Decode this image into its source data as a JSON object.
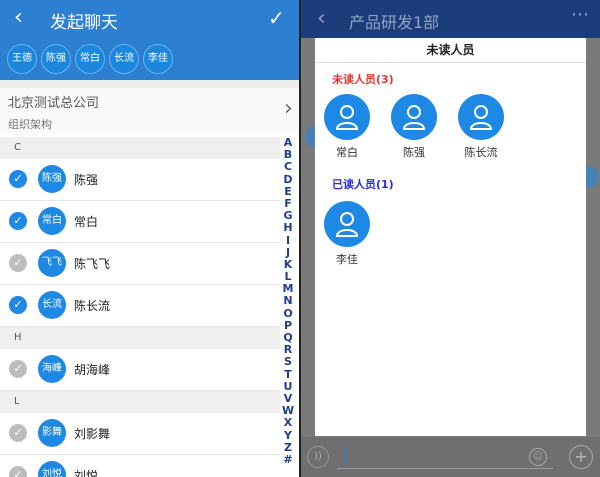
{
  "left": {
    "header": {
      "title": "发起聊天"
    },
    "selected_chips": [
      "王德",
      "陈强",
      "常白",
      "长流",
      "李佳"
    ],
    "org": {
      "name": "北京测试总公司",
      "sub": "组织架构"
    },
    "sections": [
      {
        "letter": "C",
        "rows": [
          {
            "avatar": "陈强",
            "name": "陈强",
            "checked": true
          },
          {
            "avatar": "常白",
            "name": "常白",
            "checked": true
          },
          {
            "avatar": "飞飞",
            "name": "陈飞飞",
            "checked": false
          },
          {
            "avatar": "长流",
            "name": "陈长流",
            "checked": true
          }
        ]
      },
      {
        "letter": "H",
        "rows": [
          {
            "avatar": "海峰",
            "name": "胡海峰",
            "checked": false
          }
        ]
      },
      {
        "letter": "L",
        "rows": [
          {
            "avatar": "影舞",
            "name": "刘影舞",
            "checked": false
          },
          {
            "avatar": "刘悦",
            "name": "刘悦",
            "checked": false
          }
        ]
      }
    ],
    "index_letters": [
      "A",
      "B",
      "C",
      "D",
      "E",
      "F",
      "G",
      "H",
      "I",
      "J",
      "K",
      "L",
      "M",
      "N",
      "O",
      "P",
      "Q",
      "R",
      "S",
      "T",
      "U",
      "V",
      "W",
      "X",
      "Y",
      "Z",
      "#"
    ]
  },
  "right": {
    "header": {
      "title": "产品研发1部"
    },
    "dialog": {
      "title": "未读人员",
      "unread_label": "未读人员(3)",
      "unread": [
        "常白",
        "陈强",
        "陈长流"
      ],
      "read_label": "已读人员(1)",
      "read": [
        "李佳"
      ]
    }
  },
  "colors": {
    "accent": "#1e88e5",
    "header_blue": "#2d7fd2",
    "unread_red": "#e53935",
    "read_blue": "#2b2be0"
  },
  "icons": {
    "back": "chevron-left-icon",
    "confirm": "check-icon",
    "more": "more-icon",
    "person": "person-icon"
  }
}
